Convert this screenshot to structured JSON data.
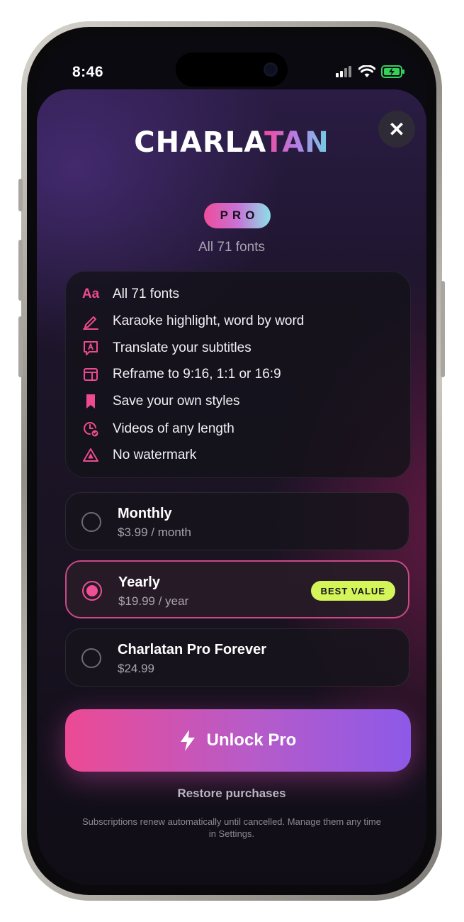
{
  "status_bar": {
    "time": "8:46"
  },
  "header": {
    "brand_part1": "CHARLA",
    "brand_part2": "TAN",
    "badge": "PRO",
    "subtitle": "All 71 fonts",
    "close_glyph": "✕"
  },
  "features": [
    {
      "icon": "font-icon",
      "glyph": "Aa",
      "label": "All 71 fonts"
    },
    {
      "icon": "pencil-icon",
      "label": "Karaoke highlight, word by word"
    },
    {
      "icon": "translate-bubble-icon",
      "label": "Translate your subtitles"
    },
    {
      "icon": "reframe-icon",
      "label": "Reframe to 9:16, 1:1 or 16:9"
    },
    {
      "icon": "bookmark-icon",
      "label": "Save your own styles"
    },
    {
      "icon": "clock-check-icon",
      "label": "Videos of any length"
    },
    {
      "icon": "warning-triangle-icon",
      "label": "No watermark"
    }
  ],
  "plans": [
    {
      "name": "Monthly",
      "price": "$3.99 / month",
      "selected": false
    },
    {
      "name": "Yearly",
      "price": "$19.99 / year",
      "selected": true,
      "badge": "BEST VALUE"
    },
    {
      "name": "Charlatan Pro Forever",
      "price": "$24.99",
      "selected": false
    }
  ],
  "cta": {
    "label": "Unlock Pro"
  },
  "restore_label": "Restore purchases",
  "fine_print": "Subscriptions renew automatically until cancelled. Manage them any time in Settings.",
  "colors": {
    "accent_pink": "#ef4f94",
    "accent_purple": "#8d59e8",
    "badge_lime": "#d3f55a"
  }
}
